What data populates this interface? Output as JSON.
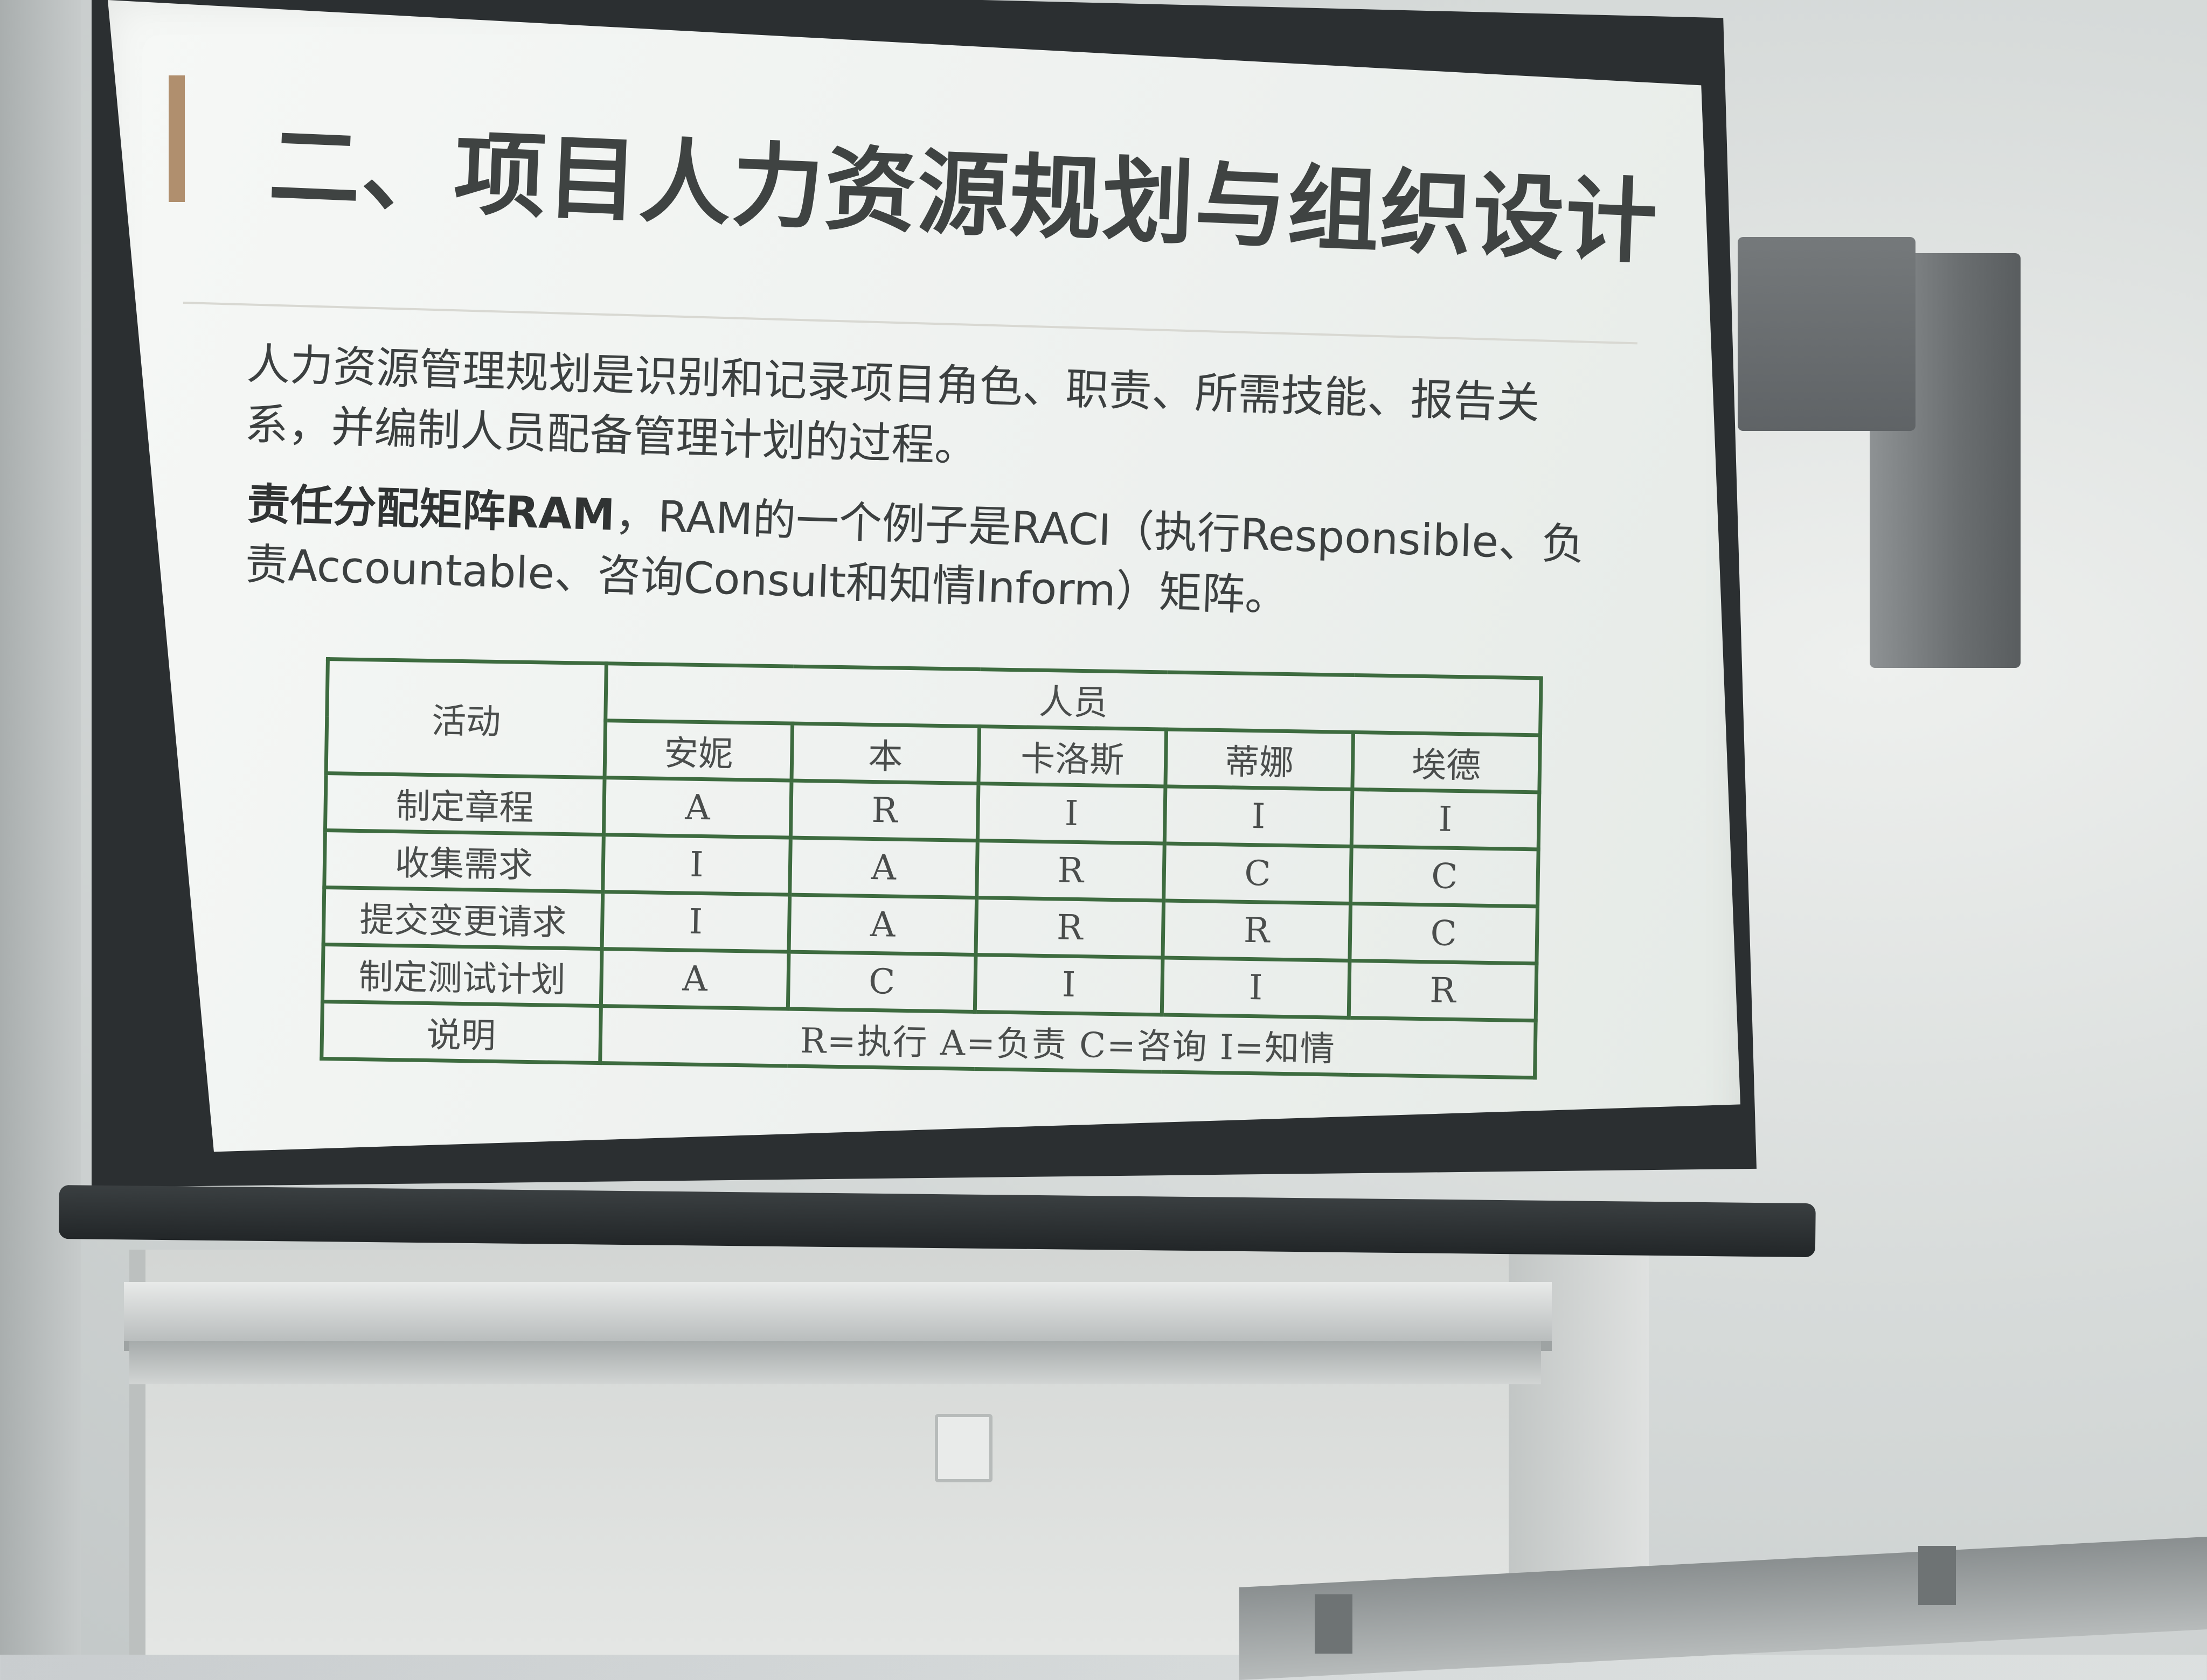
{
  "slide": {
    "title": "二、项目人力资源规划与组织设计",
    "paragraph1": "人力资源管理规划是识别和记录项目角色、职责、所需技能、报告关系，并编制人员配备管理计划的过程。",
    "paragraph2_bold": "责任分配矩阵RAM",
    "paragraph2_rest": "，RAM的一个例子是RACI（执行Responsible、负责Accountable、咨询Consult和知情Inform）矩阵。"
  },
  "raci_table": {
    "activity_header": "活动",
    "people_header": "人员",
    "people": [
      "安妮",
      "本",
      "卡洛斯",
      "蒂娜",
      "埃德"
    ],
    "rows": [
      {
        "activity": "制定章程",
        "values": [
          "A",
          "R",
          "I",
          "I",
          "I"
        ]
      },
      {
        "activity": "收集需求",
        "values": [
          "I",
          "A",
          "R",
          "C",
          "C"
        ]
      },
      {
        "activity": "提交变更请求",
        "values": [
          "I",
          "A",
          "R",
          "R",
          "C"
        ]
      },
      {
        "activity": "制定测试计划",
        "values": [
          "A",
          "C",
          "I",
          "I",
          "R"
        ]
      }
    ],
    "legend_label": "说明",
    "legend_text": "R=执行    A=负责    C=咨询    I=知情"
  }
}
